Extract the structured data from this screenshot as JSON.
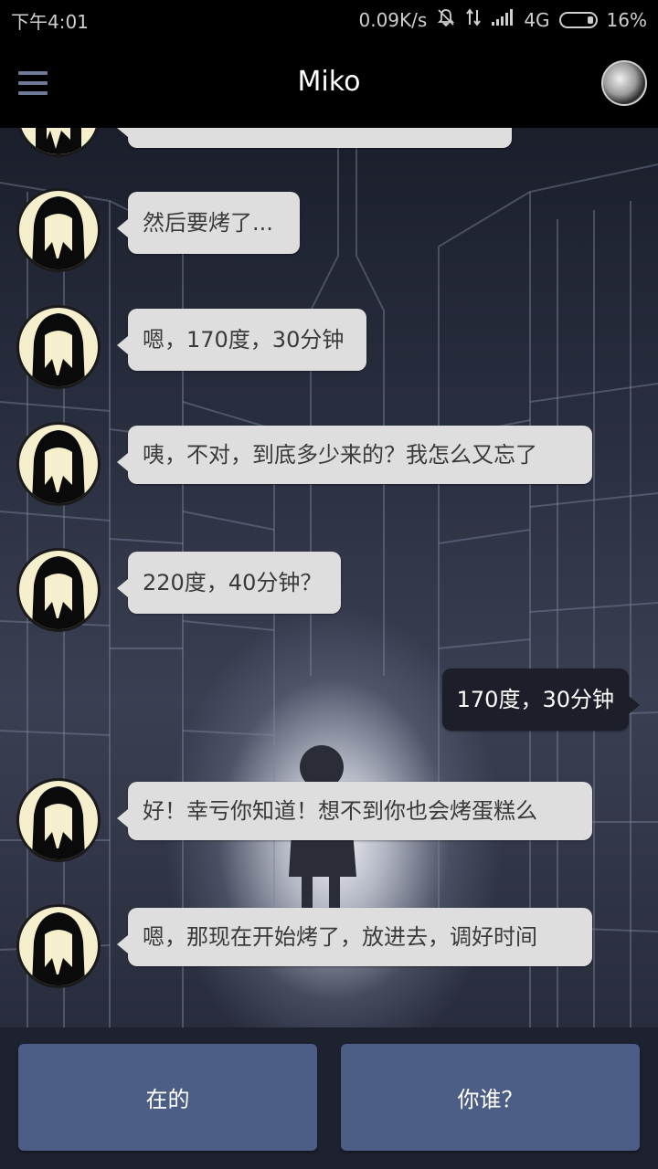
{
  "status_bar": {
    "time": "下午4:01",
    "speed": "0.09K/s",
    "network": "4G",
    "battery": "16%",
    "icons": [
      "mute-icon",
      "data-transfer-icon",
      "signal-icon",
      "battery-icon"
    ]
  },
  "header": {
    "title": "Miko",
    "menu_icon": "hamburger-icon"
  },
  "messages": [
    {
      "from": "miko",
      "text": "然后要烤了..."
    },
    {
      "from": "miko",
      "text": "嗯，170度，30分钟"
    },
    {
      "from": "miko",
      "text": "咦，不对，到底多少来的？我怎么又忘了"
    },
    {
      "from": "miko",
      "text": "220度，40分钟？"
    },
    {
      "from": "me",
      "text": "170度，30分钟"
    },
    {
      "from": "miko",
      "text": "好！幸亏你知道！想不到你也会烤蛋糕么"
    },
    {
      "from": "miko",
      "text": "嗯，那现在开始烤了，放进去，调好时间"
    }
  ],
  "replies": [
    "在的",
    "你谁？"
  ],
  "colors": {
    "bubble_other": "#dedede",
    "bubble_me": "#1c1e29",
    "reply_button": "#4c5d86"
  }
}
